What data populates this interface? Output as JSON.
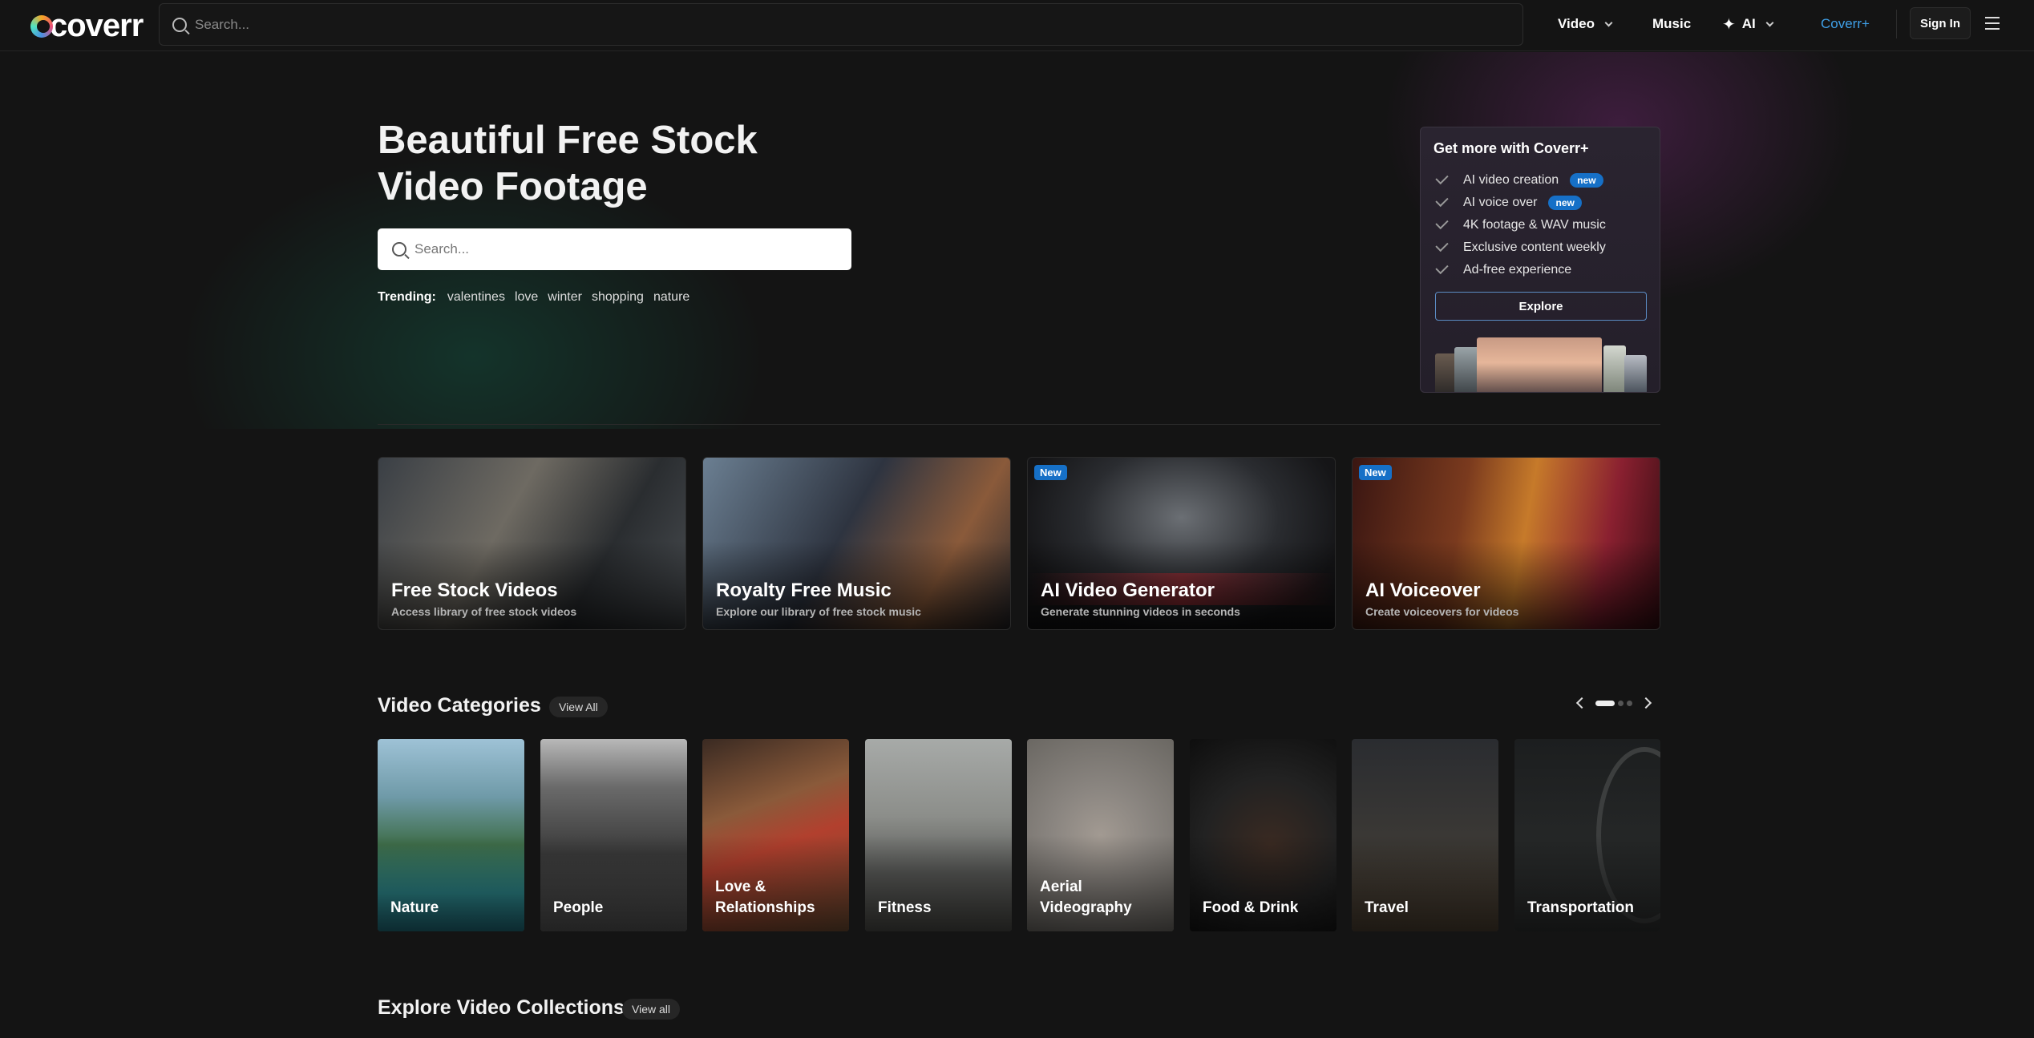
{
  "brand": {
    "logo_text": "coverr"
  },
  "nav": {
    "search_placeholder": "Search...",
    "video_label": "Video",
    "music_label": "Music",
    "ai_label": "AI",
    "coverr_plus_label": "Coverr+",
    "signin_label": "Sign In"
  },
  "colors": {
    "accent_blue": "#1670c7",
    "coverr_plus_link": "#3fa0e8",
    "background": "#141414"
  },
  "hero": {
    "title_line1": "Beautiful Free Stock",
    "title_line2": "Video Footage",
    "search_placeholder": "Search...",
    "trending_label": "Trending:",
    "trending": [
      "valentines",
      "love",
      "winter",
      "shopping",
      "nature"
    ]
  },
  "plus_card": {
    "title": "Get more with Coverr+",
    "features": [
      {
        "label": "AI video creation",
        "badge": "new"
      },
      {
        "label": "AI voice over",
        "badge": "new"
      },
      {
        "label": "4K footage & WAV music",
        "badge": ""
      },
      {
        "label": "Exclusive content weekly",
        "badge": ""
      },
      {
        "label": "Ad-free experience",
        "badge": ""
      }
    ],
    "explore_label": "Explore"
  },
  "features": [
    {
      "title": "Free Stock Videos",
      "subtitle": "Access library of free stock videos",
      "badge": ""
    },
    {
      "title": "Royalty Free Music",
      "subtitle": "Explore our library of free stock music",
      "badge": ""
    },
    {
      "title": "AI Video Generator",
      "subtitle": "Generate stunning videos in seconds",
      "badge": "New"
    },
    {
      "title": "AI Voiceover",
      "subtitle": "Create voiceovers for videos",
      "badge": "New"
    }
  ],
  "categories_section": {
    "title": "Video Categories",
    "view_all": "View All",
    "carousel": {
      "pages": 3,
      "active_page": 1
    },
    "items": [
      {
        "label": "Nature"
      },
      {
        "label": "People"
      },
      {
        "label": "Love & Relationships"
      },
      {
        "label": "Fitness"
      },
      {
        "label": "Aerial Videography"
      },
      {
        "label": "Food & Drink"
      },
      {
        "label": "Travel"
      },
      {
        "label": "Transportation"
      }
    ]
  },
  "collections_section": {
    "title": "Explore Video Collections",
    "view_all": "View all"
  }
}
